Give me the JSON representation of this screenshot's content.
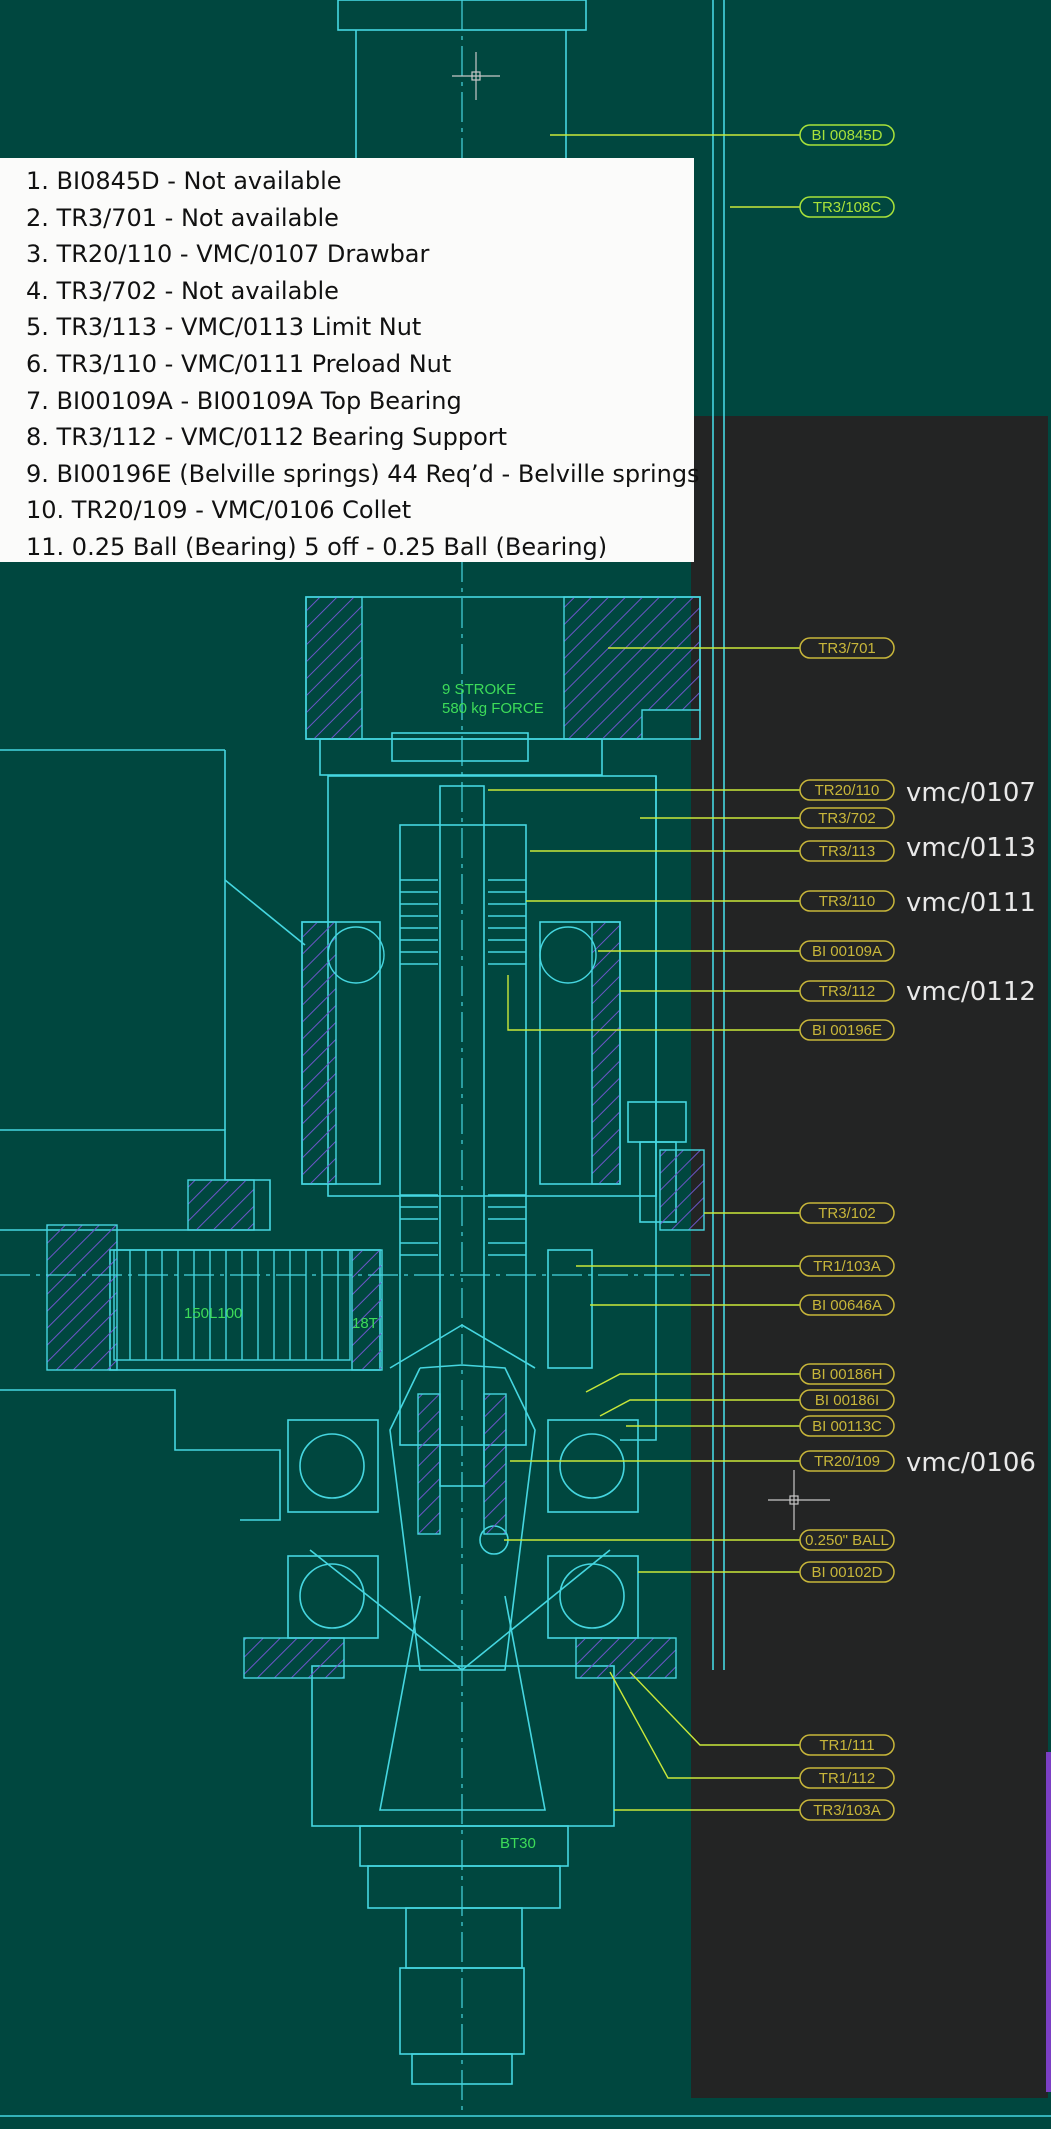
{
  "parts_list": [
    "1. BI0845D - Not available",
    "2. TR3/701 - Not available",
    "3. TR20/110 - VMC/0107 Drawbar",
    "4. TR3/702 - Not available",
    "5. TR3/113 - VMC/0113 Limit Nut",
    "6. TR3/110 - VMC/0111 Preload Nut",
    "7. BI00109A - BI00109A Top Bearing",
    "8. TR3/112 - VMC/0112 Bearing Support",
    "9. BI00196E (Belville springs) 44 Req’d - Belville springs",
    "10. TR20/109 - VMC/0106 Collet",
    "11. 0.25 Ball (Bearing) 5 off - 0.25 Ball (Bearing)"
  ],
  "tags": [
    {
      "label": "BI 00845D",
      "style": "green"
    },
    {
      "label": "TR3/108C",
      "style": "green"
    },
    {
      "label": "TR3/701",
      "style": "amber"
    },
    {
      "label": "TR20/110",
      "style": "amber"
    },
    {
      "label": "TR3/702",
      "style": "amber"
    },
    {
      "label": "TR3/113",
      "style": "amber"
    },
    {
      "label": "TR3/110",
      "style": "amber"
    },
    {
      "label": "BI 00109A",
      "style": "amber"
    },
    {
      "label": "TR3/112",
      "style": "amber"
    },
    {
      "label": "BI 00196E",
      "style": "amber"
    },
    {
      "label": "TR3/102",
      "style": "amber"
    },
    {
      "label": "TR1/103A",
      "style": "amber"
    },
    {
      "label": "BI 00646A",
      "style": "amber"
    },
    {
      "label": "BI 00186H",
      "style": "amber"
    },
    {
      "label": "BI 00186I",
      "style": "amber"
    },
    {
      "label": "BI 00113C",
      "style": "amber"
    },
    {
      "label": "TR20/109",
      "style": "amber"
    },
    {
      "label": "0.250\" BALL",
      "style": "amber"
    },
    {
      "label": "BI 00102D",
      "style": "amber"
    },
    {
      "label": "TR1/111",
      "style": "amber"
    },
    {
      "label": "TR1/112",
      "style": "amber"
    },
    {
      "label": "TR3/103A",
      "style": "amber"
    }
  ],
  "vmc_labels": [
    "vmc/0107",
    "vmc/0113",
    "vmc/0111",
    "vmc/0112",
    "vmc/0106"
  ],
  "notes": {
    "stroke": "9 STROKE",
    "force": "580 kg FORCE",
    "pulley": "150L100",
    "teeth": "18T",
    "taper": "BT30"
  },
  "colors": {
    "background": "#00473f",
    "dark_panel": "#232424",
    "outline": "#45d6e0",
    "leader": "#c9e83a",
    "tag": "#c8b63a",
    "hatch": "#6b55c8",
    "note": "#3ddc59",
    "accent": "#7b3fc4"
  }
}
